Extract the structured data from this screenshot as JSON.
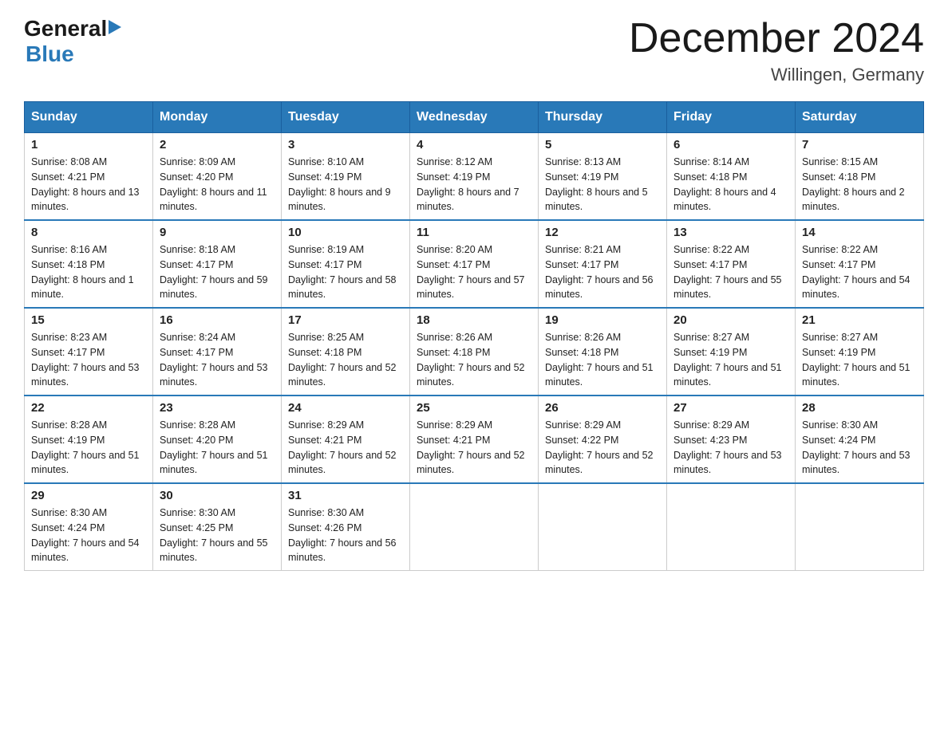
{
  "logo": {
    "general": "General",
    "arrow": "▶",
    "blue": "Blue"
  },
  "title": {
    "month_year": "December 2024",
    "location": "Willingen, Germany"
  },
  "days_of_week": [
    "Sunday",
    "Monday",
    "Tuesday",
    "Wednesday",
    "Thursday",
    "Friday",
    "Saturday"
  ],
  "weeks": [
    [
      {
        "day": "1",
        "sunrise": "8:08 AM",
        "sunset": "4:21 PM",
        "daylight": "8 hours and 13 minutes."
      },
      {
        "day": "2",
        "sunrise": "8:09 AM",
        "sunset": "4:20 PM",
        "daylight": "8 hours and 11 minutes."
      },
      {
        "day": "3",
        "sunrise": "8:10 AM",
        "sunset": "4:19 PM",
        "daylight": "8 hours and 9 minutes."
      },
      {
        "day": "4",
        "sunrise": "8:12 AM",
        "sunset": "4:19 PM",
        "daylight": "8 hours and 7 minutes."
      },
      {
        "day": "5",
        "sunrise": "8:13 AM",
        "sunset": "4:19 PM",
        "daylight": "8 hours and 5 minutes."
      },
      {
        "day": "6",
        "sunrise": "8:14 AM",
        "sunset": "4:18 PM",
        "daylight": "8 hours and 4 minutes."
      },
      {
        "day": "7",
        "sunrise": "8:15 AM",
        "sunset": "4:18 PM",
        "daylight": "8 hours and 2 minutes."
      }
    ],
    [
      {
        "day": "8",
        "sunrise": "8:16 AM",
        "sunset": "4:18 PM",
        "daylight": "8 hours and 1 minute."
      },
      {
        "day": "9",
        "sunrise": "8:18 AM",
        "sunset": "4:17 PM",
        "daylight": "7 hours and 59 minutes."
      },
      {
        "day": "10",
        "sunrise": "8:19 AM",
        "sunset": "4:17 PM",
        "daylight": "7 hours and 58 minutes."
      },
      {
        "day": "11",
        "sunrise": "8:20 AM",
        "sunset": "4:17 PM",
        "daylight": "7 hours and 57 minutes."
      },
      {
        "day": "12",
        "sunrise": "8:21 AM",
        "sunset": "4:17 PM",
        "daylight": "7 hours and 56 minutes."
      },
      {
        "day": "13",
        "sunrise": "8:22 AM",
        "sunset": "4:17 PM",
        "daylight": "7 hours and 55 minutes."
      },
      {
        "day": "14",
        "sunrise": "8:22 AM",
        "sunset": "4:17 PM",
        "daylight": "7 hours and 54 minutes."
      }
    ],
    [
      {
        "day": "15",
        "sunrise": "8:23 AM",
        "sunset": "4:17 PM",
        "daylight": "7 hours and 53 minutes."
      },
      {
        "day": "16",
        "sunrise": "8:24 AM",
        "sunset": "4:17 PM",
        "daylight": "7 hours and 53 minutes."
      },
      {
        "day": "17",
        "sunrise": "8:25 AM",
        "sunset": "4:18 PM",
        "daylight": "7 hours and 52 minutes."
      },
      {
        "day": "18",
        "sunrise": "8:26 AM",
        "sunset": "4:18 PM",
        "daylight": "7 hours and 52 minutes."
      },
      {
        "day": "19",
        "sunrise": "8:26 AM",
        "sunset": "4:18 PM",
        "daylight": "7 hours and 51 minutes."
      },
      {
        "day": "20",
        "sunrise": "8:27 AM",
        "sunset": "4:19 PM",
        "daylight": "7 hours and 51 minutes."
      },
      {
        "day": "21",
        "sunrise": "8:27 AM",
        "sunset": "4:19 PM",
        "daylight": "7 hours and 51 minutes."
      }
    ],
    [
      {
        "day": "22",
        "sunrise": "8:28 AM",
        "sunset": "4:19 PM",
        "daylight": "7 hours and 51 minutes."
      },
      {
        "day": "23",
        "sunrise": "8:28 AM",
        "sunset": "4:20 PM",
        "daylight": "7 hours and 51 minutes."
      },
      {
        "day": "24",
        "sunrise": "8:29 AM",
        "sunset": "4:21 PM",
        "daylight": "7 hours and 52 minutes."
      },
      {
        "day": "25",
        "sunrise": "8:29 AM",
        "sunset": "4:21 PM",
        "daylight": "7 hours and 52 minutes."
      },
      {
        "day": "26",
        "sunrise": "8:29 AM",
        "sunset": "4:22 PM",
        "daylight": "7 hours and 52 minutes."
      },
      {
        "day": "27",
        "sunrise": "8:29 AM",
        "sunset": "4:23 PM",
        "daylight": "7 hours and 53 minutes."
      },
      {
        "day": "28",
        "sunrise": "8:30 AM",
        "sunset": "4:24 PM",
        "daylight": "7 hours and 53 minutes."
      }
    ],
    [
      {
        "day": "29",
        "sunrise": "8:30 AM",
        "sunset": "4:24 PM",
        "daylight": "7 hours and 54 minutes."
      },
      {
        "day": "30",
        "sunrise": "8:30 AM",
        "sunset": "4:25 PM",
        "daylight": "7 hours and 55 minutes."
      },
      {
        "day": "31",
        "sunrise": "8:30 AM",
        "sunset": "4:26 PM",
        "daylight": "7 hours and 56 minutes."
      },
      null,
      null,
      null,
      null
    ]
  ]
}
